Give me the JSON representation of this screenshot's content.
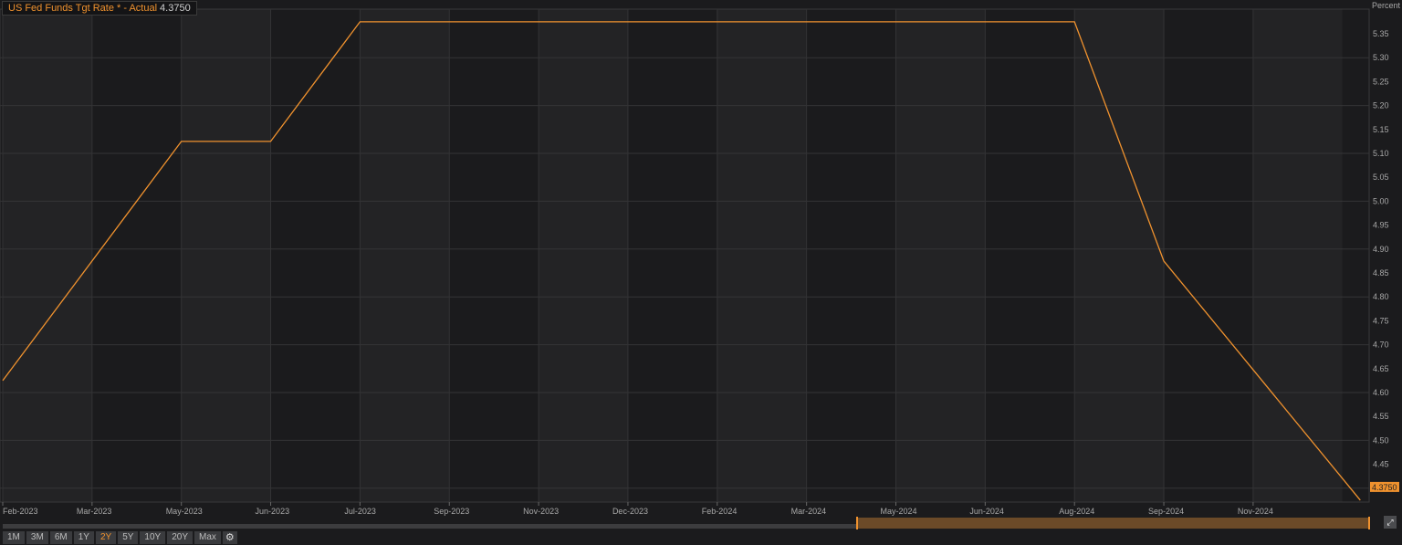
{
  "legend": {
    "series_name": "US Fed Funds Tgt Rate * - Actual",
    "last_value": "4.3750"
  },
  "range_buttons": [
    "1M",
    "3M",
    "6M",
    "1Y",
    "2Y",
    "5Y",
    "10Y",
    "20Y",
    "Max"
  ],
  "active_range": "2Y",
  "colors": {
    "line": "#f0922e",
    "background": "#1b1b1d"
  },
  "chart_data": {
    "type": "line",
    "ylabel": "Percent",
    "ylim": [
      4.375,
      5.4
    ],
    "yticks": [
      "4.40",
      "4.45",
      "4.50",
      "4.55",
      "4.60",
      "4.65",
      "4.70",
      "4.75",
      "4.80",
      "4.85",
      "4.90",
      "4.95",
      "5.00",
      "5.05",
      "5.10",
      "5.15",
      "5.20",
      "5.25",
      "5.30",
      "5.35"
    ],
    "xticks": [
      "Feb-2023",
      "Mar-2023",
      "May-2023",
      "Jun-2023",
      "Jul-2023",
      "Sep-2023",
      "Nov-2023",
      "Dec-2023",
      "Feb-2024",
      "Mar-2024",
      "May-2024",
      "Jun-2024",
      "Aug-2024",
      "Sep-2024",
      "Nov-2024"
    ],
    "series": [
      {
        "name": "US Fed Funds Tgt Rate * - Actual",
        "x_tick_index": [
          0,
          2,
          3,
          4,
          12,
          13,
          15.2
        ],
        "values": [
          4.625,
          5.125,
          5.125,
          5.375,
          5.375,
          4.875,
          4.375
        ]
      }
    ],
    "last_value_label": "4.3750"
  }
}
